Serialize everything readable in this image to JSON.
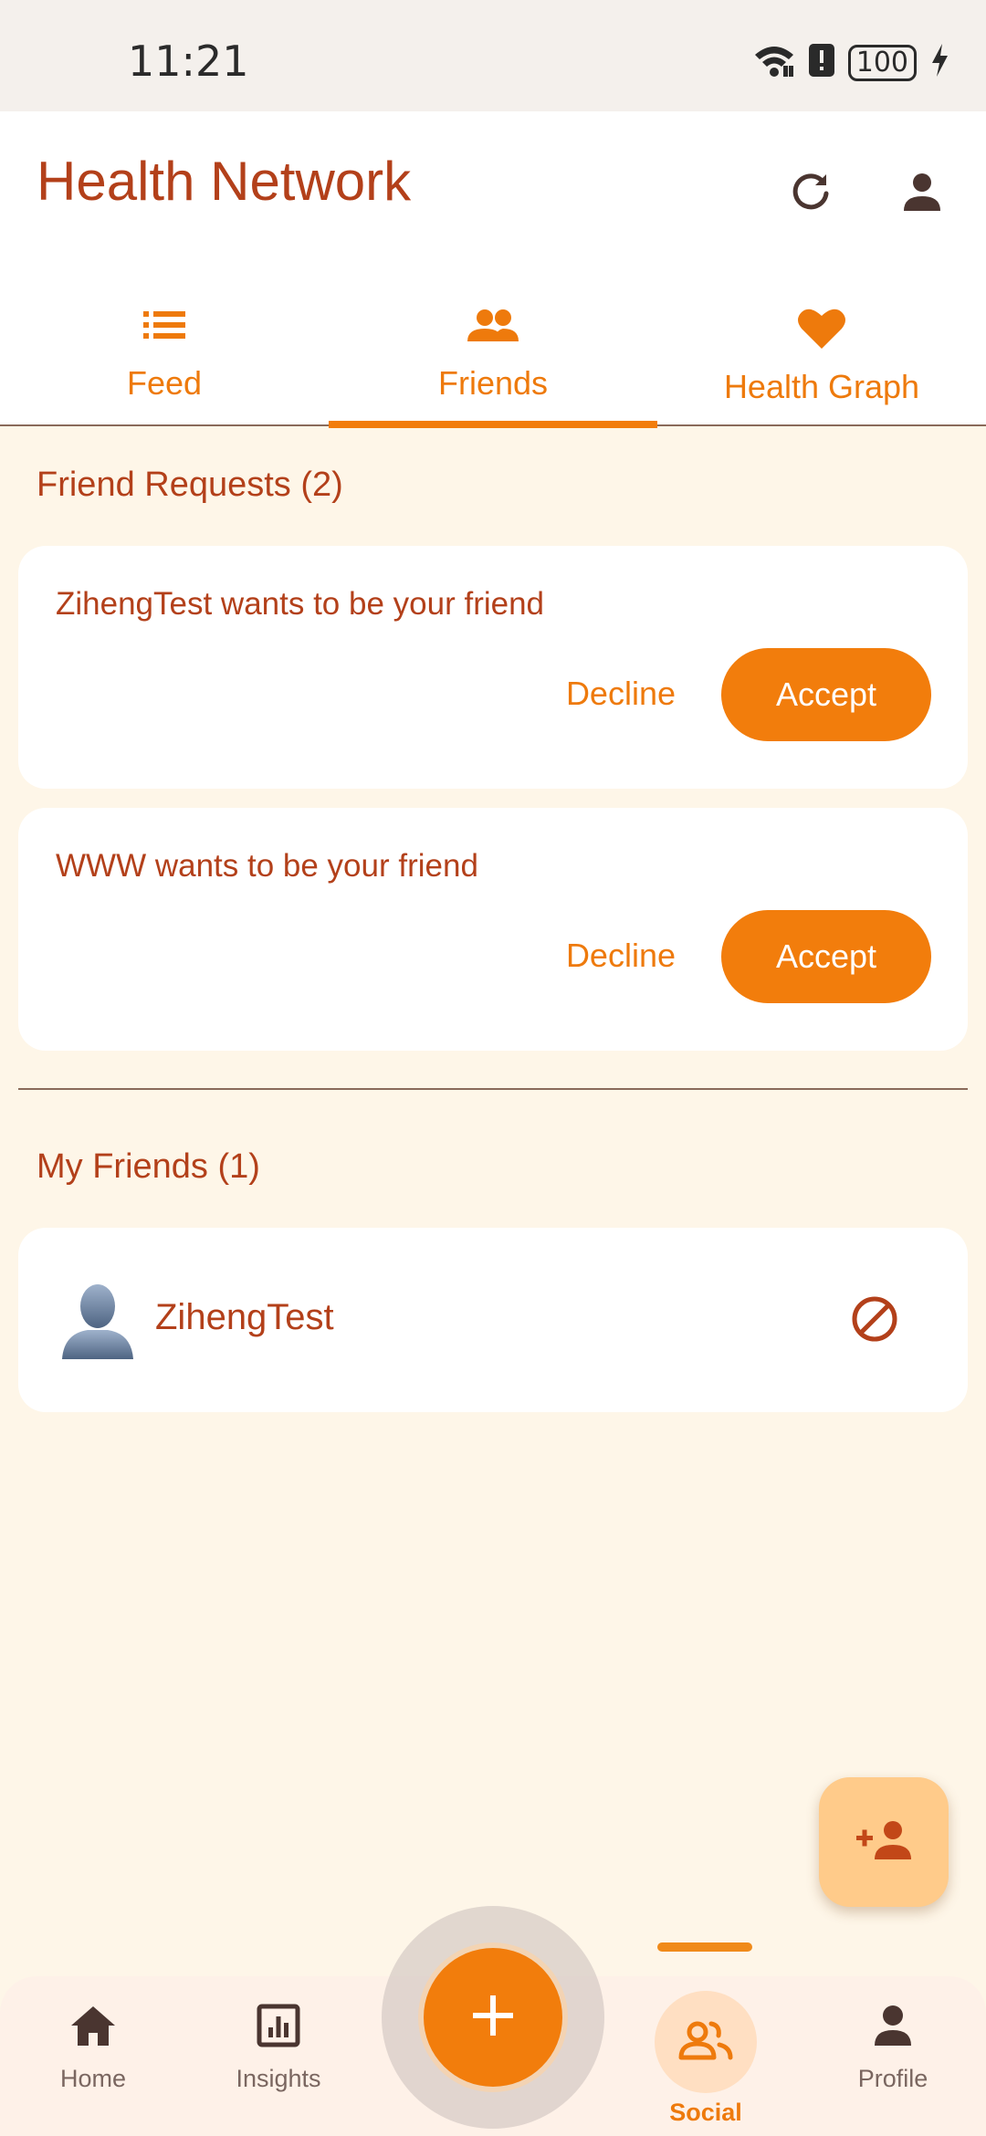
{
  "status_bar": {
    "time": "11:21",
    "battery": "100",
    "icons": [
      "wifi-icon",
      "alert-icon",
      "battery-icon",
      "charging-icon"
    ]
  },
  "app_bar": {
    "title": "Health Network",
    "actions": [
      "refresh-icon",
      "account-icon"
    ]
  },
  "tabs": [
    {
      "label": "Feed",
      "icon": "list-icon",
      "active": false
    },
    {
      "label": "Friends",
      "icon": "people-icon",
      "active": true
    },
    {
      "label": "Health Graph",
      "icon": "heart-icon",
      "active": false
    }
  ],
  "requests": {
    "title": "Friend Requests (2)",
    "items": [
      {
        "text": "ZihengTest wants to be your friend",
        "decline": "Decline",
        "accept": "Accept"
      },
      {
        "text": "WWW wants to be your friend",
        "decline": "Decline",
        "accept": "Accept"
      }
    ]
  },
  "friends": {
    "title": "My Friends (1)",
    "items": [
      {
        "name": "ZihengTest",
        "action_icon": "block-icon"
      }
    ]
  },
  "fab": {
    "icon": "person-add-icon"
  },
  "bottom_nav": {
    "items": [
      {
        "label": "Home",
        "icon": "home-icon"
      },
      {
        "label": "Insights",
        "icon": "insights-icon"
      },
      {
        "label": "Social",
        "icon": "social-icon",
        "active": true
      },
      {
        "label": "Profile",
        "icon": "person-icon"
      }
    ],
    "center_action_icon": "plus-icon"
  },
  "colors": {
    "primary": "#F27D0C",
    "title_text": "#B3401A",
    "background": "#FEF6E8",
    "fab_light": "#FFCB8A"
  }
}
